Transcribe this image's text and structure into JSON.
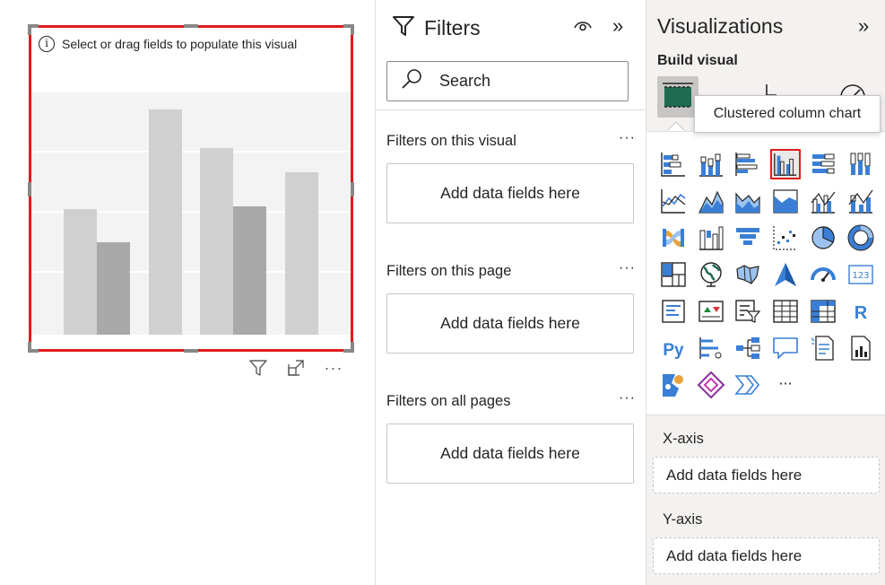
{
  "canvas": {
    "visual_placeholder_text": "Select or drag fields to populate this visual",
    "info_glyph": "i",
    "placeholder_bars": [
      {
        "value": 0.52,
        "shade": "light"
      },
      {
        "value": 0.38,
        "shade": "dark"
      },
      {
        "value": 0.93,
        "shade": "light"
      },
      {
        "value": 0.77,
        "shade": "light"
      },
      {
        "value": 0.53,
        "shade": "dark"
      },
      {
        "value": 0.67,
        "shade": "light"
      }
    ],
    "toolbar": {
      "more_label": "···"
    },
    "selection_color": "#e01b1b"
  },
  "filters": {
    "title": "Filters",
    "collapse_glyph": "»",
    "search_placeholder": "Search",
    "sections": [
      {
        "title": "Filters on this visual",
        "more": "···",
        "well": "Add data fields here"
      },
      {
        "title": "Filters on this page",
        "more": "···",
        "well": "Add data fields here"
      },
      {
        "title": "Filters on all pages",
        "more": "···",
        "well": "Add data fields here"
      }
    ]
  },
  "visualizations": {
    "title": "Visualizations",
    "collapse_glyph": "»",
    "build_visual_label": "Build visual",
    "tooltip": "Clustered column chart",
    "gallery": [
      [
        "stacked-bar-chart-icon",
        "stacked-column-chart-icon",
        "clustered-bar-chart-icon",
        "clustered-column-chart-icon",
        "100-stacked-bar-chart-icon",
        "100-stacked-column-chart-icon"
      ],
      [
        "line-chart-icon",
        "area-chart-icon",
        "stacked-area-chart-icon",
        "100-stacked-area-chart-icon",
        "line-clustered-column-chart-icon",
        "line-stacked-column-chart-icon"
      ],
      [
        "ribbon-chart-icon",
        "waterfall-chart-icon",
        "funnel-chart-icon",
        "scatter-chart-icon",
        "pie-chart-icon",
        "donut-chart-icon"
      ],
      [
        "treemap-icon",
        "map-icon",
        "filled-map-icon",
        "azure-map-icon",
        "gauge-icon",
        "card-icon"
      ],
      [
        "multi-row-card-icon",
        "kpi-icon",
        "slicer-icon",
        "table-icon",
        "matrix-icon",
        "r-visual-icon"
      ],
      [
        "python-visual-icon",
        "key-influencers-icon",
        "decomposition-tree-icon",
        "qa-icon",
        "smart-narrative-icon",
        "paginated-report-icon"
      ],
      [
        "arcgis-map-icon",
        "power-apps-icon",
        "power-automate-icon",
        "more-visuals-icon"
      ]
    ],
    "card_text": "123",
    "r_text": "R",
    "python_text": "Py",
    "more_text": "···",
    "wells": [
      {
        "label": "X-axis",
        "placeholder": "Add data fields here"
      },
      {
        "label": "Y-axis",
        "placeholder": "Add data fields here"
      }
    ],
    "accent_color": "#3a7fd5"
  }
}
